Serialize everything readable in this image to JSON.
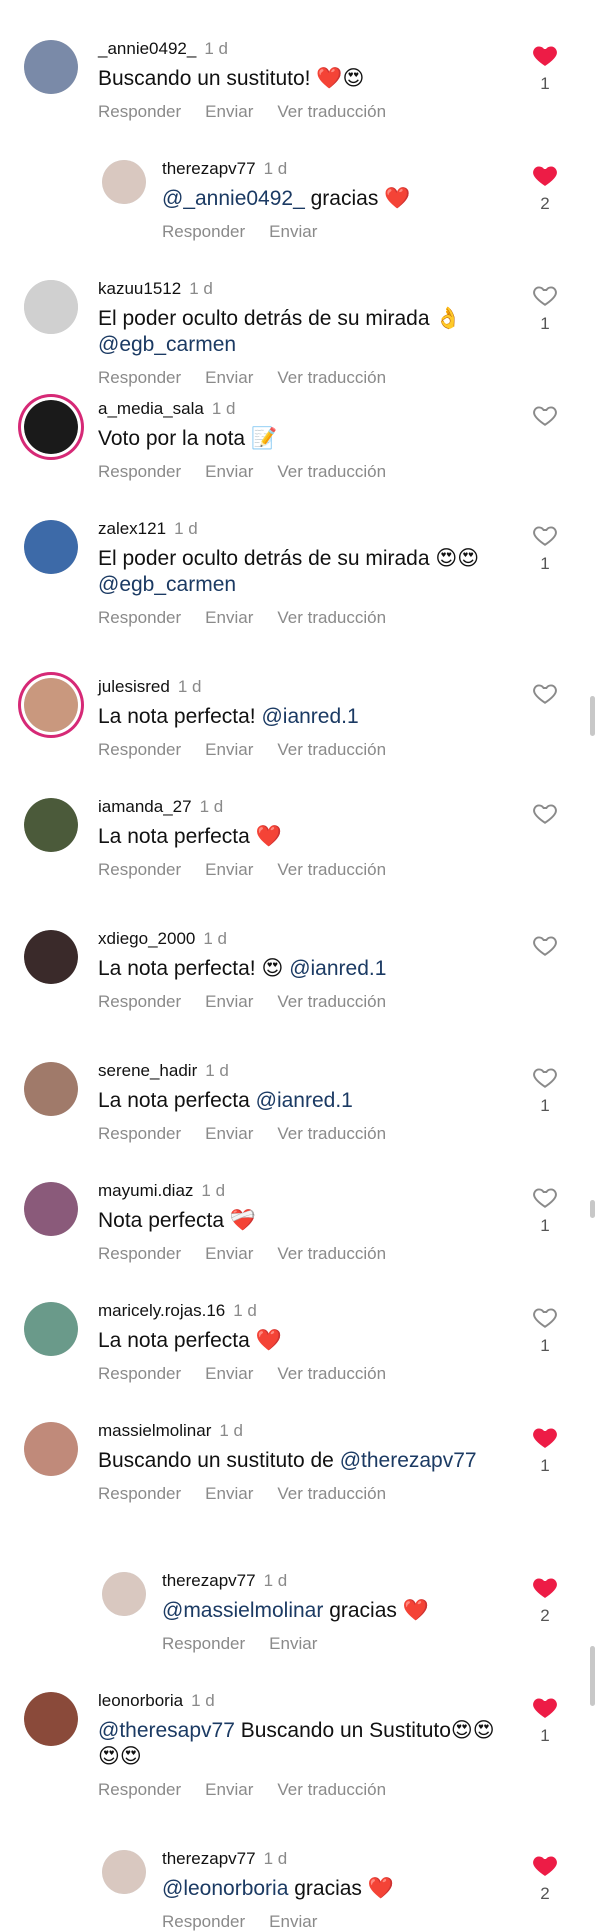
{
  "colors": {
    "like_red": "#ed1c46",
    "mention": "#1b3a63",
    "muted": "#8a8a8a"
  },
  "actions": {
    "reply": "Responder",
    "send": "Enviar",
    "translate": "Ver traducción"
  },
  "comments": [
    {
      "user": "_annie0492_",
      "time": "1 d",
      "text": "Buscando un sustituto! ❤️😍",
      "likes": "1",
      "liked": true,
      "translate": true
    },
    {
      "user": "therezapv77",
      "time": "1 d",
      "mention": "@_annie0492_",
      "text": "gracias ❤️",
      "likes": "2",
      "liked": true,
      "translate": false,
      "reply": true
    },
    {
      "user": "kazuu1512",
      "time": "1 d",
      "text": "El poder oculto detrás de su mirada 👌",
      "mention2": "@egb_carmen",
      "likes": "1",
      "liked": false,
      "translate": true
    },
    {
      "user": "a_media_sala",
      "time": "1 d",
      "text": "Voto por la nota 📝",
      "likes": "",
      "liked": false,
      "translate": true
    },
    {
      "user": "zalex121",
      "time": "1 d",
      "text": "El poder oculto detrás de su mirada 😍😍",
      "mention2": "@egb_carmen",
      "likes": "1",
      "liked": false,
      "translate": true
    },
    {
      "user": "julesisred",
      "time": "1 d",
      "text": "La nota perfecta!",
      "mention_after": "@ianred.1",
      "likes": "",
      "liked": false,
      "translate": true
    },
    {
      "user": "iamanda_27",
      "time": "1 d",
      "text": "La nota perfecta ❤️",
      "likes": "",
      "liked": false,
      "translate": true
    },
    {
      "user": "xdiego_2000",
      "time": "1 d",
      "text": "La nota perfecta! 😍",
      "mention_after": "@ianred.1",
      "likes": "",
      "liked": false,
      "translate": true
    },
    {
      "user": "serene_hadir",
      "time": "1 d",
      "text": "La nota perfecta",
      "mention_after": "@ianred.1",
      "likes": "1",
      "liked": false,
      "translate": true
    },
    {
      "user": "mayumi.diaz",
      "time": "1 d",
      "text": "Nota perfecta ❤️‍🩹",
      "likes": "1",
      "liked": false,
      "translate": true
    },
    {
      "user": "maricely.rojas.16",
      "time": "1 d",
      "text": "La nota perfecta ❤️",
      "likes": "1",
      "liked": false,
      "translate": true
    },
    {
      "user": "massielmolinar",
      "time": "1 d",
      "text": "Buscando un sustituto de",
      "mention_after": "@therezapv77",
      "likes": "1",
      "liked": true,
      "translate": true
    },
    {
      "user": "therezapv77",
      "time": "1 d",
      "mention": "@massielmolinar",
      "text": "gracias ❤️",
      "likes": "2",
      "liked": true,
      "translate": false,
      "reply": true
    },
    {
      "user": "leonorboria",
      "time": "1 d",
      "mention": "@theresapv77",
      "text": "Buscando un Sustituto😍😍\n😍😍",
      "likes": "1",
      "liked": true,
      "translate": true
    },
    {
      "user": "therezapv77",
      "time": "1 d",
      "mention": "@leonorboria",
      "text": "gracias ❤️",
      "likes": "2",
      "liked": true,
      "translate": false,
      "reply": true
    }
  ]
}
